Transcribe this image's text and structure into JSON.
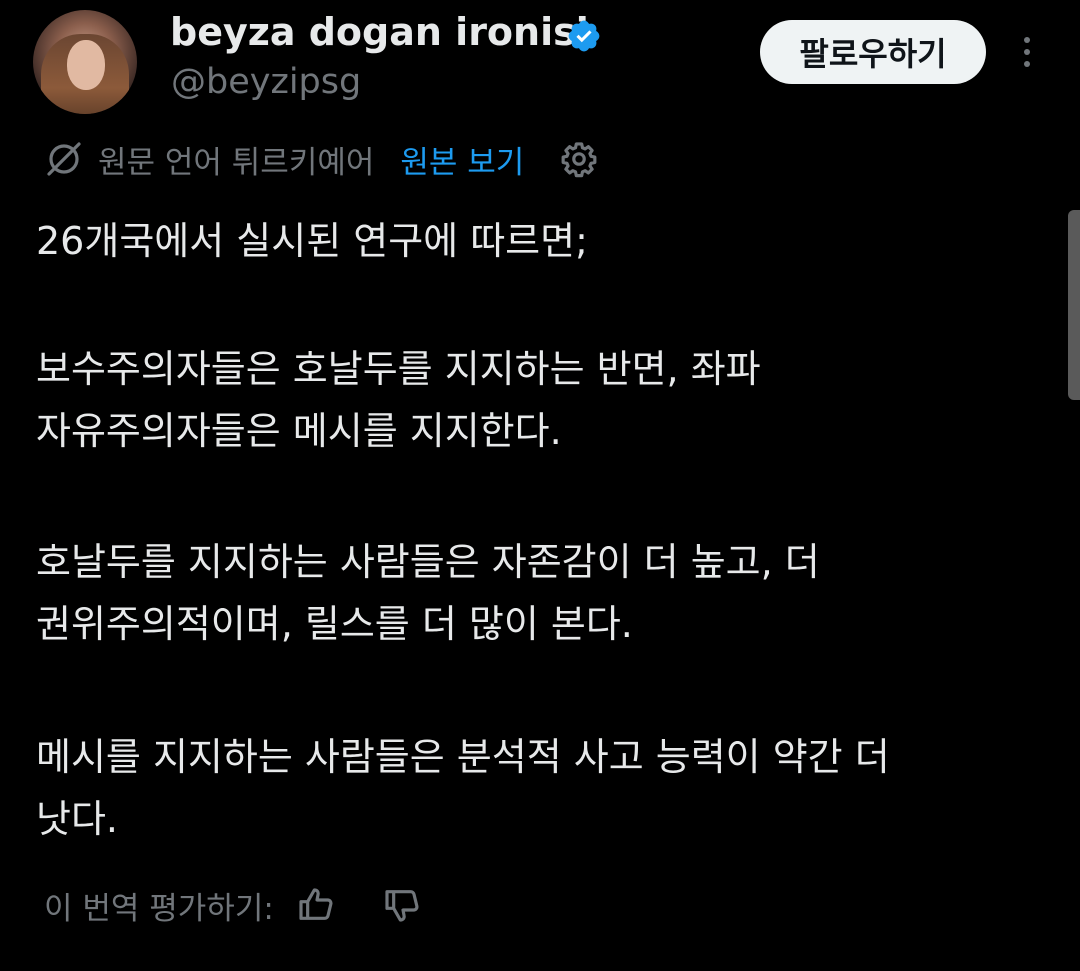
{
  "tweet": {
    "author": {
      "name": "beyza dogan ironisi",
      "handle": "@beyzipsg",
      "verified": true,
      "verified_color": "#1d9bf0"
    },
    "follow_label": "팔로우하기",
    "more_icon": "more-vertical-icon",
    "translation": {
      "icon": "globe-slash-icon",
      "source_language_label": "원문 언어 튀르키예어",
      "show_original_label": "원본 보기",
      "settings_icon": "gear-icon"
    },
    "text": {
      "p1": "26개국에서 실시된 연구에 따르면;",
      "p2_line1": "보수주의자들은 호날두를 지지하는 반면, 좌파",
      "p2_line2": "자유주의자들은 메시를 지지한다.",
      "p3_line1": "호날두를 지지하는 사람들은 자존감이 더 높고, 더",
      "p3_line2": "권위주의적이며, 릴스를 더 많이 본다.",
      "p4_line1": "메시를 지지하는 사람들은 분석적 사고 능력이 약간 더",
      "p4_line2": "낫다."
    },
    "rate_translation": {
      "label": "이 번역 평가하기:",
      "thumbs_up_icon": "thumbs-up-icon",
      "thumbs_down_icon": "thumbs-down-icon"
    }
  },
  "colors": {
    "background": "#000000",
    "text_primary": "#e7e9ea",
    "text_secondary": "#71767b",
    "link": "#1d9bf0",
    "follow_button_bg": "#eff3f4"
  }
}
